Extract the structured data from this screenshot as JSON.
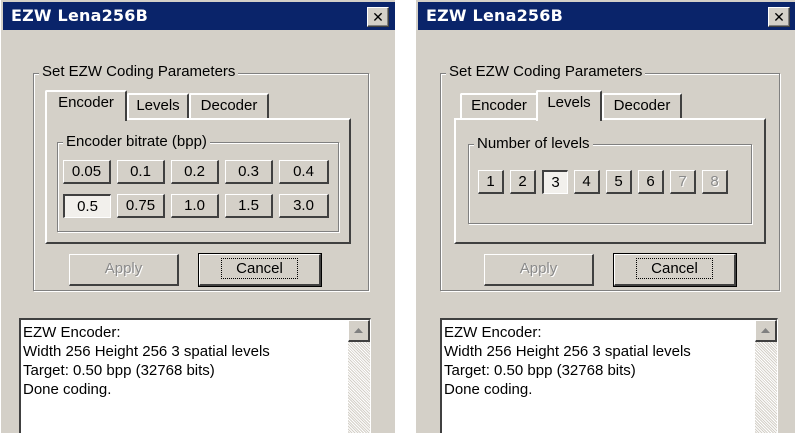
{
  "windows": [
    {
      "title": "EZW Lena256B",
      "group_label": "Set EZW Coding Parameters",
      "tabs": [
        "Encoder",
        "Levels",
        "Decoder"
      ],
      "active_tab": "Encoder",
      "encoder_group_label": "Encoder bitrate (bpp)",
      "bitrate_rows": [
        [
          "0.05",
          "0.1",
          "0.2",
          "0.3",
          "0.4"
        ],
        [
          "0.5",
          "0.75",
          "1.0",
          "1.5",
          "3.0"
        ]
      ],
      "selected_bitrate": "0.5",
      "apply_label": "Apply",
      "cancel_label": "Cancel",
      "log": [
        "EZW Encoder:",
        "Width 256   Height 256   3 spatial levels",
        "Target: 0.50 bpp  (32768 bits)",
        "Done coding."
      ]
    },
    {
      "title": "EZW Lena256B",
      "group_label": "Set EZW Coding Parameters",
      "tabs": [
        "Encoder",
        "Levels",
        "Decoder"
      ],
      "active_tab": "Levels",
      "levels_group_label": "Number of levels",
      "levels": [
        "1",
        "2",
        "3",
        "4",
        "5",
        "6",
        "7",
        "8"
      ],
      "selected_level": "3",
      "disabled_levels": [
        "7",
        "8"
      ],
      "apply_label": "Apply",
      "cancel_label": "Cancel",
      "log": [
        "EZW Encoder:",
        "Width 256   Height 256   3 spatial levels",
        "Target: 0.50 bpp  (32768 bits)",
        "Done coding."
      ]
    }
  ],
  "icons": {
    "close": "close-icon",
    "scroll_up": "arrow-up-icon"
  },
  "colors": {
    "titlebar": "#0a246a",
    "face": "#d4d0c8"
  }
}
